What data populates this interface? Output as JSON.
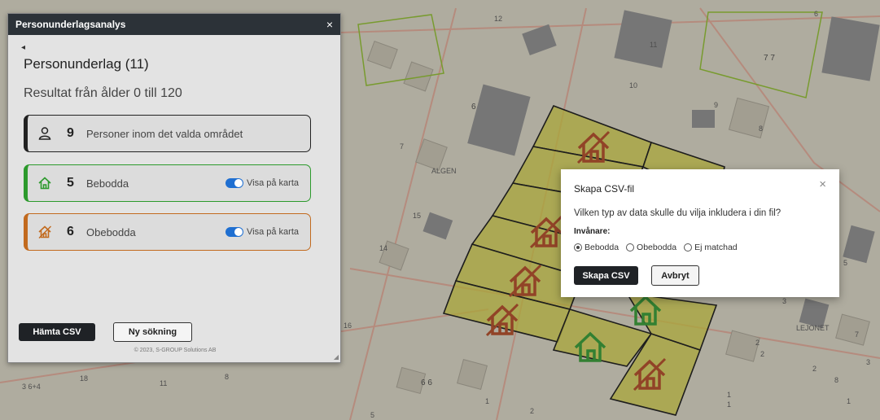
{
  "panel": {
    "title": "Personunderlagsanalys",
    "close": "×",
    "back": "◂",
    "heading": "Personunderlag (11)",
    "subheading": "Resultat från ålder 0 till 120",
    "cards": {
      "persons": {
        "count": "9",
        "label": "Personer inom det valda området",
        "icon": "person-icon",
        "color": "#222222"
      },
      "bebodda": {
        "count": "5",
        "label": "Bebodda",
        "toggle_label": "Visa på karta",
        "toggle_on": true,
        "icon": "house-icon",
        "color": "#2c9a2c"
      },
      "obebodda": {
        "count": "6",
        "label": "Obebodda",
        "toggle_label": "Visa på karta",
        "toggle_on": true,
        "icon": "house-crossed-icon",
        "color": "#c26a1e"
      }
    },
    "buttons": {
      "fetch_csv": "Hämta CSV",
      "new_search": "Ny sökning"
    },
    "copyright": "© 2023, S-GROUP Solutions AB"
  },
  "modal": {
    "title": "Skapa CSV-fil",
    "close": "×",
    "question": "Vilken typ av data skulle du vilja inkludera i din fil?",
    "group_label": "Invånare:",
    "options": [
      {
        "label": "Bebodda",
        "selected": true
      },
      {
        "label": "Obebodda",
        "selected": false
      },
      {
        "label": "Ej matchad",
        "selected": false
      }
    ],
    "create_button": "Skapa CSV",
    "cancel_button": "Avbryt"
  },
  "map": {
    "labels": [
      "12",
      "11",
      "7 7",
      "10",
      "9",
      "8",
      "6",
      "7",
      "ALGEN",
      "15",
      "14",
      "16",
      "18",
      "11",
      "8",
      "6 6",
      "1",
      "2",
      "5",
      "3 6+4",
      "LEJONET",
      "7",
      "3",
      "2",
      "2",
      "1",
      "1",
      "5",
      "6",
      "1",
      "8",
      "2",
      "3"
    ],
    "colors": {
      "parcel_fill": "#d4cf3a",
      "inhabited": "#2e9a2e",
      "uninhabited": "#b2461f",
      "road": "#e0a08a",
      "building": "#8a8a8a"
    }
  }
}
